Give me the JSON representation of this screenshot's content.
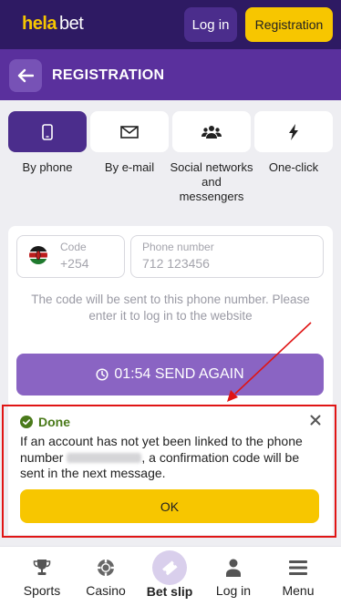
{
  "header": {
    "logo_part1": "hela",
    "logo_part2": "bet",
    "login_label": "Log in",
    "registration_label": "Registration"
  },
  "titlebar": {
    "title": "REGISTRATION"
  },
  "methods": [
    {
      "label": "By phone",
      "icon": "phone-icon",
      "active": true
    },
    {
      "label": "By e-mail",
      "icon": "mail-icon",
      "active": false
    },
    {
      "label": "Social networks and messengers",
      "icon": "users-icon",
      "active": false
    },
    {
      "label": "One-click",
      "icon": "lightning-icon",
      "active": false
    }
  ],
  "form": {
    "code_label": "Code",
    "code_value": "+254",
    "phone_label": "Phone number",
    "phone_placeholder": "712 123456",
    "hint": "The code will be sent to this phone number. Please enter it to log in to the website",
    "send_again_label": "01:54 SEND AGAIN"
  },
  "toast": {
    "status": "Done",
    "message_before": "If an account has not yet been linked to the phone number ",
    "message_after": ", a confirmation code will be sent in the next message.",
    "ok_label": "OK"
  },
  "bottom_nav": {
    "items": [
      {
        "label": "Sports",
        "icon": "trophy-icon"
      },
      {
        "label": "Casino",
        "icon": "casino-chip-icon"
      },
      {
        "label": "Bet slip",
        "icon": "ticket-icon"
      },
      {
        "label": "Log in",
        "icon": "user-icon"
      },
      {
        "label": "Menu",
        "icon": "menu-icon"
      }
    ]
  },
  "colors": {
    "header_bg": "#2e1a63",
    "titlebar_bg": "#5a309d",
    "accent_yellow": "#f7c600",
    "active_purple": "#4b2d8c",
    "send_button": "#8a64c3",
    "done_green": "#4a7a1a",
    "annotation_red": "#e01515"
  }
}
